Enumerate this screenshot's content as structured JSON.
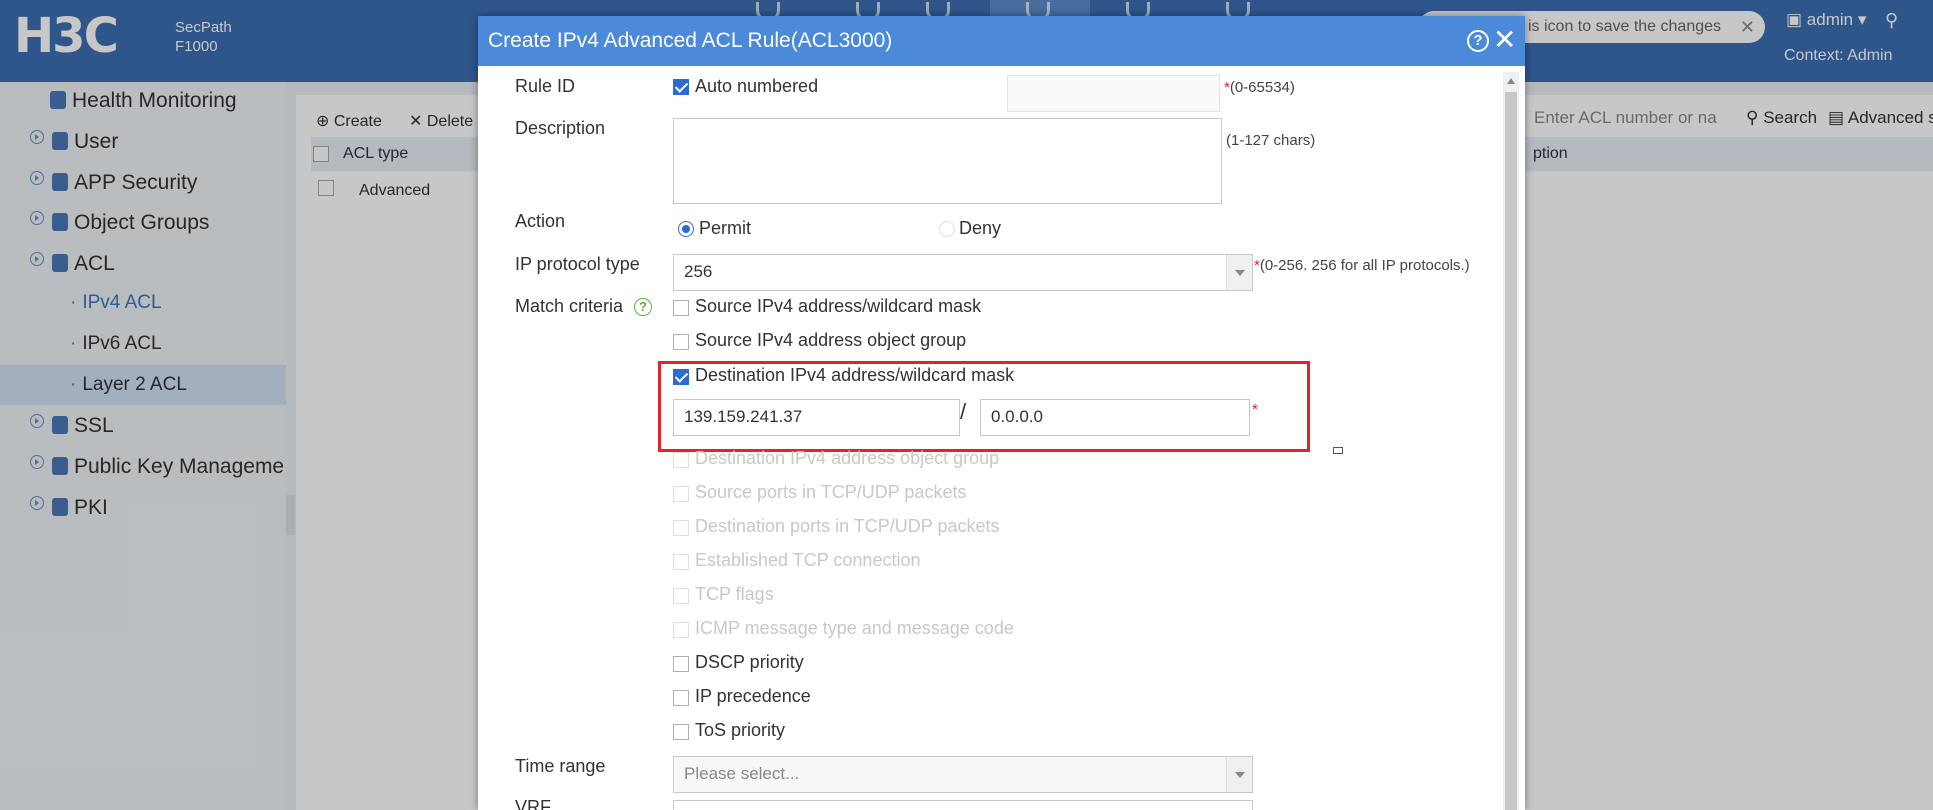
{
  "header": {
    "logo": "H3C",
    "product_line1": "SecPath",
    "product_line2": "F1000",
    "hint_text": "is icon to save the changes",
    "hint_close": "✕",
    "user": "admin ▾",
    "context": "Context: Admin"
  },
  "sidebar": {
    "items": [
      {
        "label": "Health Monitoring"
      },
      {
        "label": "User"
      },
      {
        "label": "APP Security"
      },
      {
        "label": "Object Groups"
      },
      {
        "label": "ACL"
      },
      {
        "label": "IPv4 ACL"
      },
      {
        "label": "IPv6 ACL"
      },
      {
        "label": "Layer 2 ACL"
      },
      {
        "label": "SSL"
      },
      {
        "label": "Public Key Manageme"
      },
      {
        "label": "PKI"
      }
    ]
  },
  "content": {
    "toolbar": {
      "create": "Create",
      "delete": "Delete"
    },
    "search": {
      "placeholder": "Enter ACL number or na",
      "search": "Search",
      "advanced": "Advanced s"
    },
    "table": {
      "col_type": "ACL type",
      "col_desc": "ption",
      "row_type": "Advanced"
    }
  },
  "dialog": {
    "title": "Create IPv4 Advanced ACL Rule(ACL3000)",
    "rule_id": {
      "label": "Rule ID",
      "auto": "Auto numbered",
      "hint": "(0-65534)"
    },
    "description": {
      "label": "Description",
      "hint": "(1-127 chars)"
    },
    "action": {
      "label": "Action",
      "permit": "Permit",
      "deny": "Deny"
    },
    "protocol": {
      "label": "IP protocol type",
      "value": "256",
      "hint": "(0-256. 256 for all IP protocols.)"
    },
    "match": {
      "label": "Match criteria",
      "options": [
        {
          "label": "Source IPv4 address/wildcard mask"
        },
        {
          "label": "Source IPv4 address object group"
        },
        {
          "label": "Destination IPv4 address/wildcard mask"
        },
        {
          "label": "Destination IPv4 address object group"
        },
        {
          "label": "Source ports in TCP/UDP packets"
        },
        {
          "label": "Destination ports in TCP/UDP packets"
        },
        {
          "label": "Established TCP connection"
        },
        {
          "label": "TCP flags"
        },
        {
          "label": "ICMP message type and message code"
        },
        {
          "label": "DSCP priority"
        },
        {
          "label": "IP precedence"
        },
        {
          "label": "ToS priority"
        }
      ],
      "dest_ip": "139.159.241.37",
      "dest_sep": "/",
      "dest_mask": "0.0.0.0"
    },
    "time_range": {
      "label": "Time range",
      "placeholder": "Please select..."
    },
    "vrf": {
      "label": "VRF"
    }
  }
}
